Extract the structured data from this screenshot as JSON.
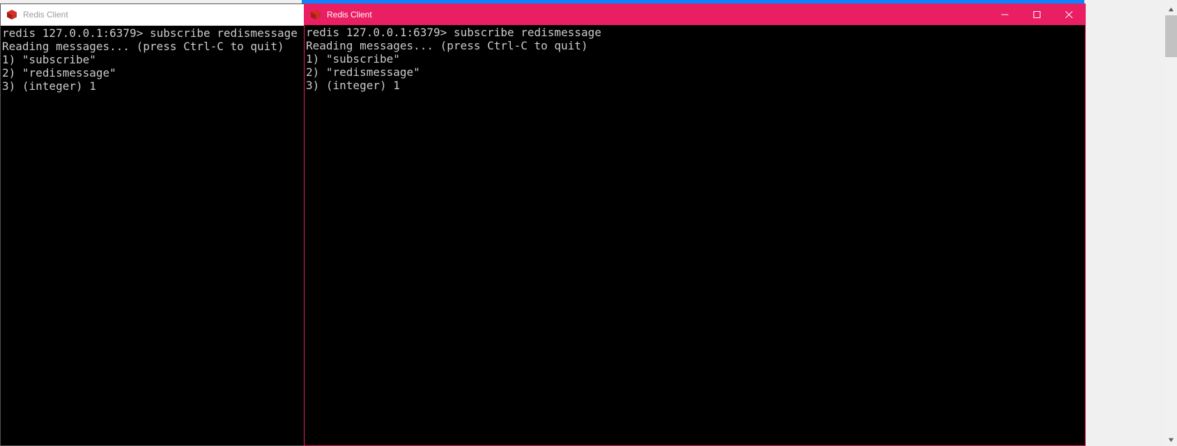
{
  "top_accent_color": "#0A84FF",
  "windows": {
    "left": {
      "title": "Redis Client",
      "active": false,
      "terminal": {
        "prompt": "redis 127.0.0.1:6379>",
        "command": "subscribe redismessage",
        "lines": [
          "Reading messages... (press Ctrl-C to quit)",
          "1) \"subscribe\"",
          "2) \"redismessage\"",
          "3) (integer) 1"
        ]
      }
    },
    "right": {
      "title": "Redis Client",
      "active": true,
      "accent_color": "#e91e63",
      "controls": {
        "minimize_glyph": "—",
        "maximize_glyph": "☐",
        "close_glyph": "✕"
      },
      "terminal": {
        "prompt": "redis 127.0.0.1:6379>",
        "command": "subscribe redismessage",
        "lines": [
          "Reading messages... (press Ctrl-C to quit)",
          "1) \"subscribe\"",
          "2) \"redismessage\"",
          "3) (integer) 1"
        ]
      }
    }
  }
}
